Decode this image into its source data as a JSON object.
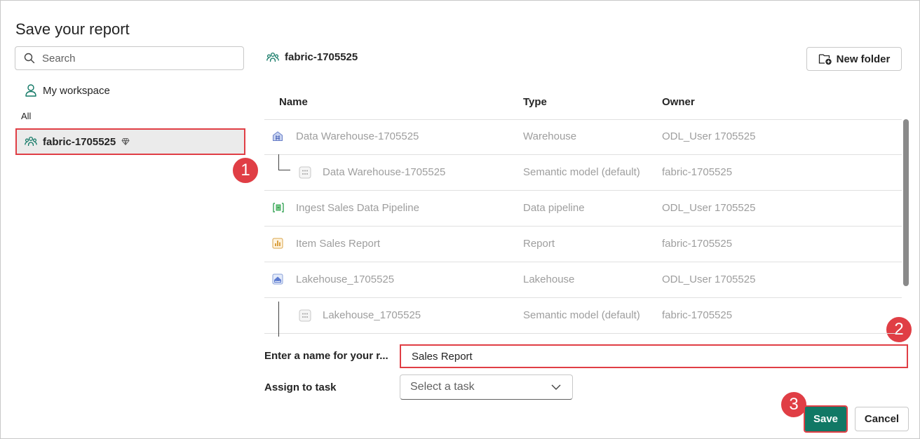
{
  "dialog": {
    "title": "Save your report"
  },
  "search": {
    "placeholder": "Search"
  },
  "sidebar": {
    "my_workspace": "My workspace",
    "all_label": "All",
    "selected_workspace": "fabric-1705525"
  },
  "breadcrumb": {
    "workspace": "fabric-1705525"
  },
  "toolbar": {
    "new_folder": "New folder"
  },
  "table": {
    "headers": {
      "name": "Name",
      "type": "Type",
      "owner": "Owner"
    },
    "rows": [
      {
        "name": "Data Warehouse-1705525",
        "type": "Warehouse",
        "owner": "ODL_User 1705525",
        "icon": "warehouse-icon"
      },
      {
        "name": "Data Warehouse-1705525",
        "type": "Semantic model (default)",
        "owner": "fabric-1705525",
        "icon": "semantic-model-icon"
      },
      {
        "name": "Ingest Sales Data Pipeline",
        "type": "Data pipeline",
        "owner": "ODL_User 1705525",
        "icon": "pipeline-icon"
      },
      {
        "name": "Item Sales Report",
        "type": "Report",
        "owner": "fabric-1705525",
        "icon": "report-icon"
      },
      {
        "name": "Lakehouse_1705525",
        "type": "Lakehouse",
        "owner": "ODL_User 1705525",
        "icon": "lakehouse-icon"
      },
      {
        "name": "Lakehouse_1705525",
        "type": "Semantic model (default)",
        "owner": "fabric-1705525",
        "icon": "semantic-model-icon"
      }
    ]
  },
  "form": {
    "name_label": "Enter a name for your r...",
    "name_value": "Sales Report",
    "task_label": "Assign to task",
    "task_placeholder": "Select a task"
  },
  "buttons": {
    "save": "Save",
    "cancel": "Cancel"
  },
  "callouts": {
    "one": "1",
    "two": "2",
    "three": "3"
  },
  "colors": {
    "accent": "#117865",
    "highlight": "#e03e45",
    "workspace_icon": "#117865"
  }
}
